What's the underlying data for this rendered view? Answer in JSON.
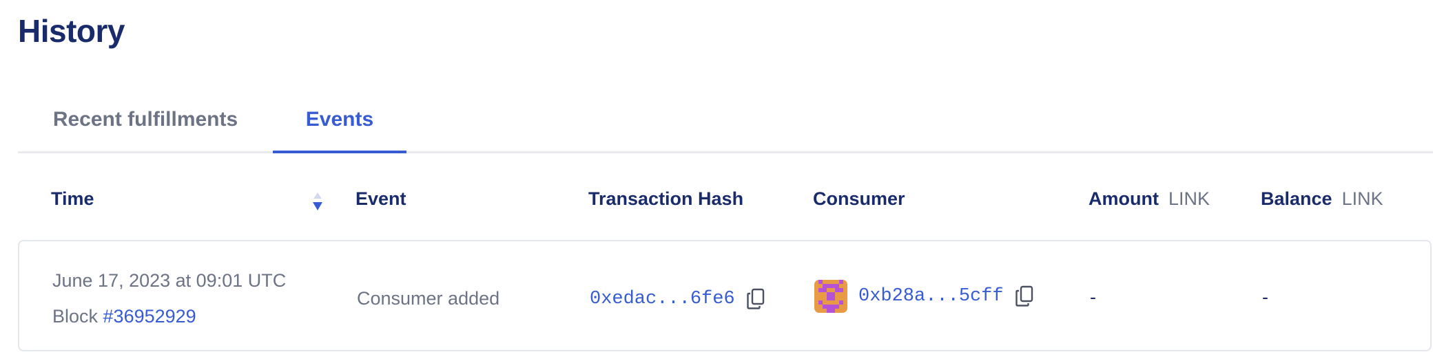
{
  "page": {
    "title": "History"
  },
  "tabs": [
    {
      "label": "Recent fulfillments",
      "active": false
    },
    {
      "label": "Events",
      "active": true
    }
  ],
  "table": {
    "columns": {
      "time": "Time",
      "event": "Event",
      "transaction_hash": "Transaction Hash",
      "consumer": "Consumer",
      "amount": "Amount",
      "amount_unit": "LINK",
      "balance": "Balance",
      "balance_unit": "LINK"
    },
    "rows": [
      {
        "date": "June 17, 2023 at 09:01 UTC",
        "block_prefix": "Block ",
        "block_number": "#36952929",
        "event": "Consumer added",
        "transaction_hash": "0xedac...6fe6",
        "consumer": "0xb28a...5cff",
        "amount": "-",
        "balance": "-"
      }
    ]
  },
  "icons": {
    "sort": "sort-descending-icon",
    "copy": "copy-icon",
    "avatar": "identicon-avatar"
  },
  "colors": {
    "accent": "#375bd2",
    "heading": "#1a2b6b",
    "muted": "#6c7385",
    "avatar_bg": "#e89a45",
    "avatar_fg": "#b552d8"
  }
}
